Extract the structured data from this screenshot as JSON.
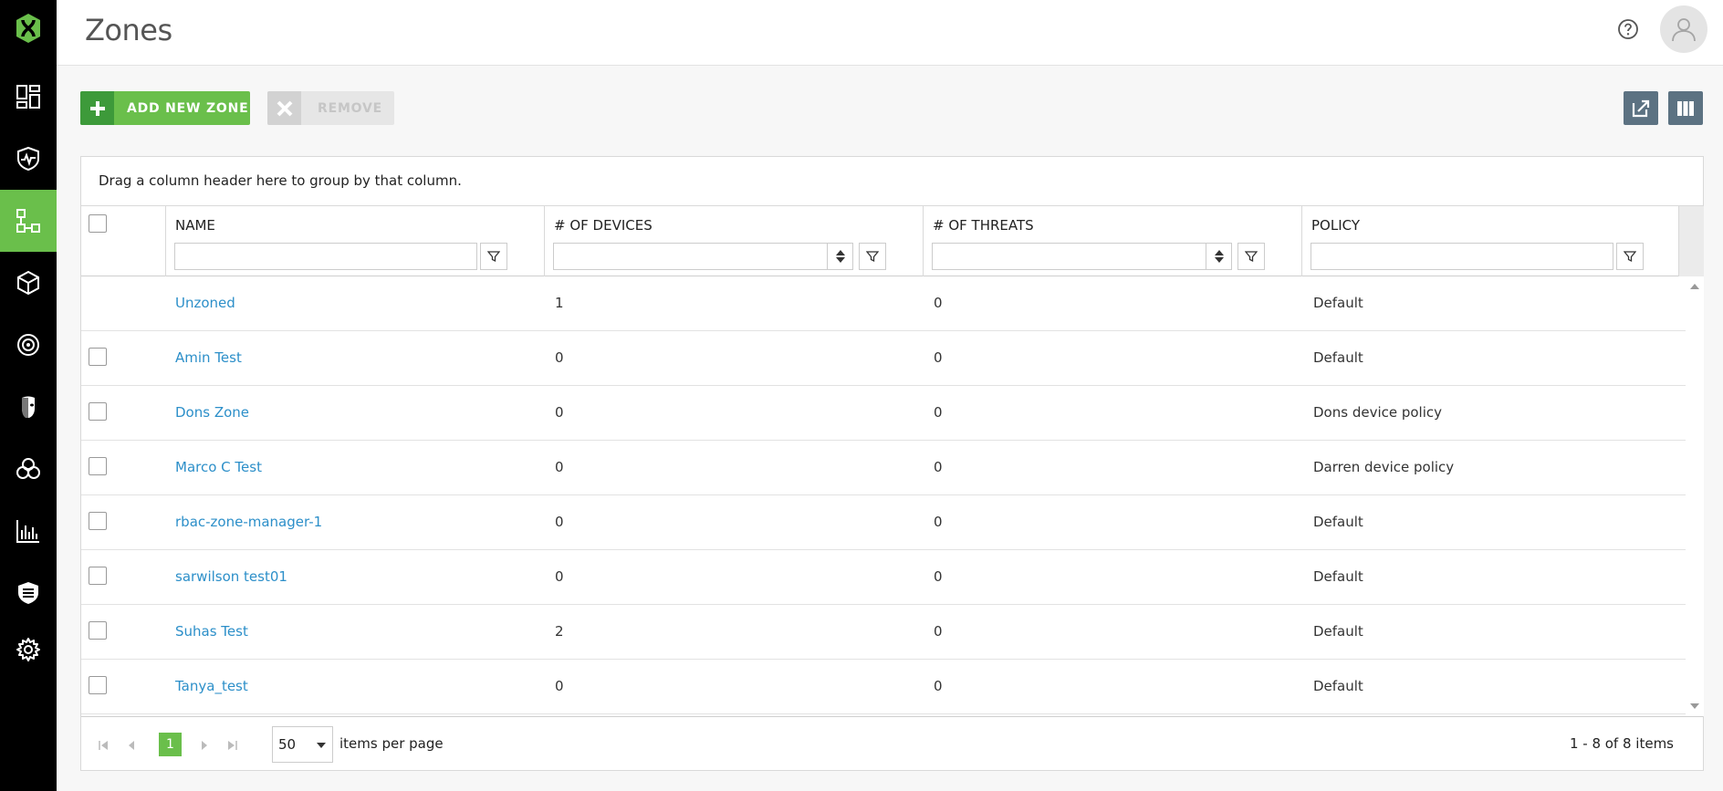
{
  "sidebar": {
    "logo": "brand-logo",
    "items": [
      {
        "icon": "dashboard-icon"
      },
      {
        "icon": "shield-heartbeat-icon"
      },
      {
        "icon": "zones-icon",
        "active": true
      },
      {
        "icon": "package-icon"
      },
      {
        "icon": "target-icon"
      },
      {
        "icon": "mask-icon"
      },
      {
        "icon": "biohazard-icon"
      },
      {
        "icon": "bar-chart-icon"
      },
      {
        "icon": "shield-list-icon"
      },
      {
        "icon": "gear-icon"
      }
    ],
    "accent": "#6abf4b"
  },
  "header": {
    "title": "Zones",
    "help_icon": "help-icon",
    "avatar_icon": "user-avatar-icon"
  },
  "toolbar": {
    "add_label": "ADD NEW ZONE",
    "remove_label": "REMOVE",
    "export_icon": "export-icon",
    "columns_icon": "columns-icon"
  },
  "grid": {
    "group_hint": "Drag a column header here to group by that column.",
    "columns": [
      "NAME",
      "# OF DEVICES",
      "# OF THREATS",
      "POLICY"
    ],
    "rows": [
      {
        "name": "Unzoned",
        "devices": "1",
        "threats": "0",
        "policy": "Default",
        "checkbox": false
      },
      {
        "name": "Amin Test",
        "devices": "0",
        "threats": "0",
        "policy": "Default",
        "checkbox": true
      },
      {
        "name": "Dons Zone",
        "devices": "0",
        "threats": "0",
        "policy": "Dons device policy",
        "checkbox": true
      },
      {
        "name": "Marco C Test",
        "devices": "0",
        "threats": "0",
        "policy": "Darren device policy",
        "checkbox": true
      },
      {
        "name": "rbac-zone-manager-1",
        "devices": "0",
        "threats": "0",
        "policy": "Default",
        "checkbox": true
      },
      {
        "name": "sarwilson test01",
        "devices": "0",
        "threats": "0",
        "policy": "Default",
        "checkbox": true
      },
      {
        "name": "Suhas Test",
        "devices": "2",
        "threats": "0",
        "policy": "Default",
        "checkbox": true
      },
      {
        "name": "Tanya_test",
        "devices": "0",
        "threats": "0",
        "policy": "Default",
        "checkbox": true
      }
    ]
  },
  "pager": {
    "current_page": "1",
    "page_size": "50",
    "per_page_label": "items per page",
    "info": "1 - 8 of 8 items"
  }
}
